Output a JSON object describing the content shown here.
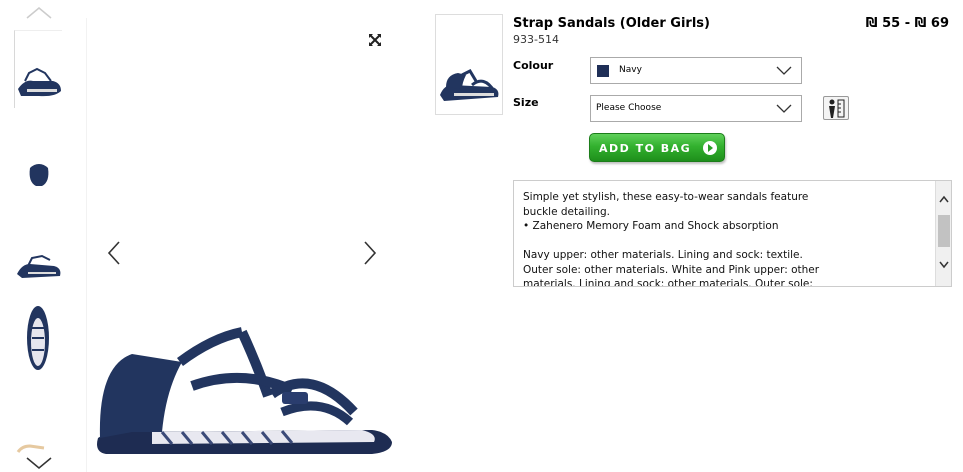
{
  "product": {
    "title": "Strap Sandals (Older Girls)",
    "sku": "933-514",
    "price": "₪ 55 - ₪ 69"
  },
  "options": {
    "colour_label": "Colour",
    "colour_value": "Navy",
    "colour_swatch": "#1f2f57",
    "size_label": "Size",
    "size_value": "Please Choose"
  },
  "actions": {
    "add_to_bag": "ADD TO BAG"
  },
  "description": {
    "line1": "Simple yet stylish, these easy-to-wear sandals feature buckle detailing.",
    "line2": "• Zahenero Memory Foam and Shock absorption",
    "line3": "Navy upper: other materials. Lining and sock: textile. Outer sole: other materials. White and Pink upper: other materials. Lining and sock: other materials. Outer sole: other materials."
  },
  "icons": {
    "expand": "expand-icon",
    "prev": "chevron-left-icon",
    "next": "chevron-right-icon",
    "thumb_up": "chevron-up-icon",
    "thumb_down": "chevron-down-icon",
    "size_guide": "size-guide-icon",
    "button_arrow": "arrow-circle-icon"
  },
  "colors": {
    "navy": "#1f2f57",
    "button_green": "#33b12f"
  }
}
